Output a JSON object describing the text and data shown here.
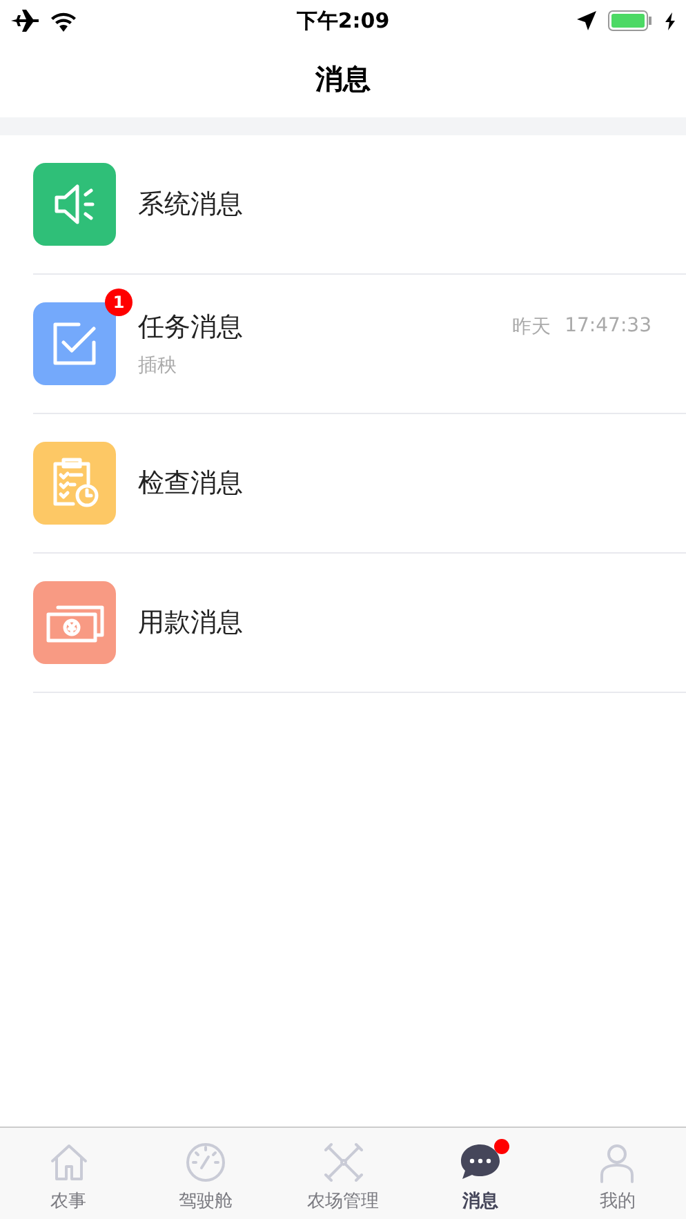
{
  "status_bar": {
    "time": "下午2:09"
  },
  "nav": {
    "title": "消息"
  },
  "messages": [
    {
      "kind": "speaker",
      "color": "#2fbf78",
      "title": "系统消息"
    },
    {
      "kind": "task",
      "color": "#74a9fb",
      "title": "任务消息",
      "subtitle": "插秧",
      "badge": "1",
      "day": "昨天",
      "time": "17:47:33"
    },
    {
      "kind": "checklist",
      "color": "#fdc865",
      "title": "检查消息"
    },
    {
      "kind": "money",
      "color": "#f89a83",
      "title": "用款消息"
    }
  ],
  "tabbar": [
    {
      "kind": "home",
      "label": "农事",
      "selected": false,
      "dot": false
    },
    {
      "kind": "gauge",
      "label": "驾驶舱",
      "selected": false,
      "dot": false
    },
    {
      "kind": "tools",
      "label": "农场管理",
      "selected": false,
      "dot": false
    },
    {
      "kind": "chat",
      "label": "消息",
      "selected": true,
      "dot": true
    },
    {
      "kind": "person",
      "label": "我的",
      "selected": false,
      "dot": false
    }
  ]
}
